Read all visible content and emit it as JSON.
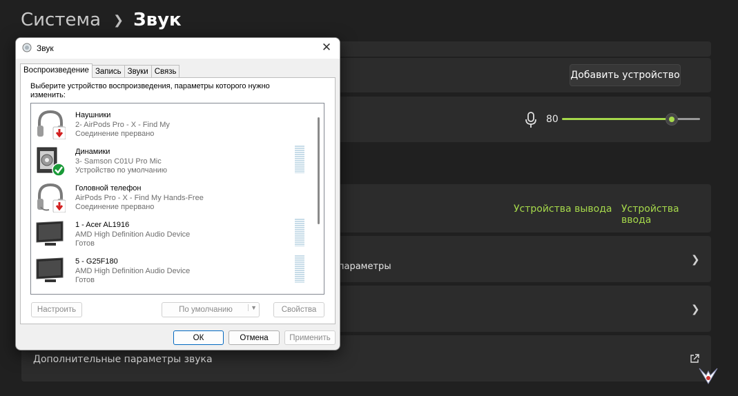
{
  "breadcrumb": {
    "parent": "Система",
    "current": "Звук"
  },
  "settings": {
    "add_device": "Добавить устройство",
    "volume_value": "80",
    "volume_level": 0.78,
    "output_devices": "Устройства вывода",
    "input_devices": "Устройства ввода",
    "partial_text": "параметры",
    "more_sound_settings": "Дополнительные параметры звука"
  },
  "dialog": {
    "title": "Звук",
    "tabs": [
      {
        "label": "Воспроизведение"
      },
      {
        "label": "Запись"
      },
      {
        "label": "Звуки"
      },
      {
        "label": "Связь"
      }
    ],
    "instruction": "Выберите устройство воспроизведения, параметры которого нужно изменить:",
    "devices": [
      {
        "name": "Наушники",
        "desc": "2- AirPods Pro - X - Find My",
        "status": "Соединение прервано",
        "icon": "headphones-icon",
        "badge": "disconnected"
      },
      {
        "name": "Динамики",
        "desc": "3- Samson C01U Pro Mic",
        "status": "Устройство по умолчанию",
        "icon": "speaker-icon",
        "badge": "default"
      },
      {
        "name": "Головной телефон",
        "desc": "AirPods Pro - X - Find My Hands-Free",
        "status": "Соединение прервано",
        "icon": "headset-icon",
        "badge": "disconnected"
      },
      {
        "name": "1 - Acer AL1916",
        "desc": "AMD High Definition Audio Device",
        "status": "Готов",
        "icon": "monitor-icon",
        "badge": "none"
      },
      {
        "name": "5 - G25F180",
        "desc": "AMD High Definition Audio Device",
        "status": "Готов",
        "icon": "monitor-icon",
        "badge": "none"
      }
    ],
    "buttons": {
      "configure": "Настроить",
      "set_default": "По умолчанию",
      "properties": "Свойства",
      "ok": "ОК",
      "cancel": "Отмена",
      "apply": "Применить"
    }
  },
  "colors": {
    "accent": "#a6d94b",
    "background": "#202020",
    "card": "#2c2c2c"
  }
}
